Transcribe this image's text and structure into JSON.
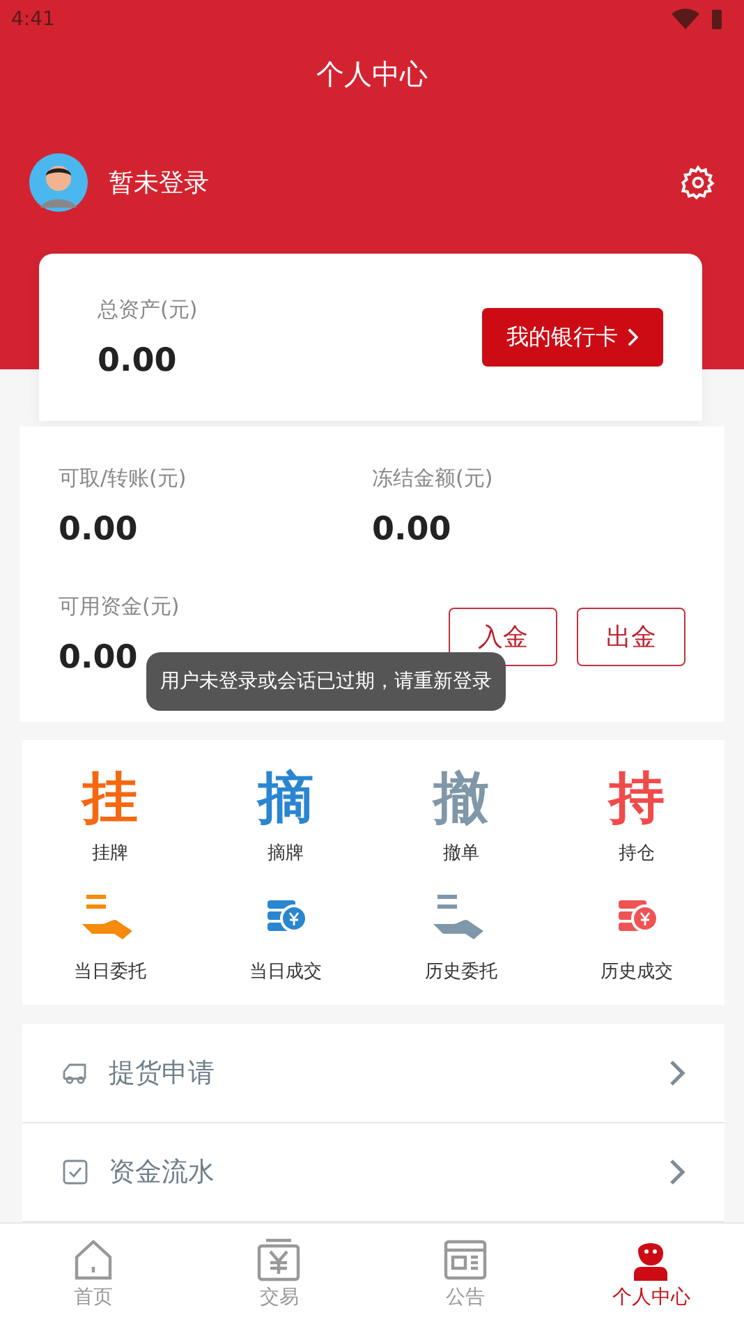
{
  "status_bar": {
    "time": "4:41"
  },
  "header": {
    "title": "个人中心",
    "user_name": "暂未登录"
  },
  "total_assets": {
    "label": "总资产(元)",
    "value": "0.00",
    "button": "我的银行卡"
  },
  "balances": [
    {
      "label": "可取/转账(元)",
      "value": "0.00"
    },
    {
      "label": "冻结金额(元)",
      "value": "0.00"
    },
    {
      "label": "可用资金(元)",
      "value": "0.00"
    }
  ],
  "fund_buttons": [
    "入金",
    "出金"
  ],
  "toast": "用户未登录或会话已过期，请重新登录",
  "shortcuts": [
    {
      "kind": "char",
      "glyph": "挂",
      "label": "挂牌",
      "color": "#f5680f"
    },
    {
      "kind": "char",
      "glyph": "摘",
      "label": "摘牌",
      "color": "#2a86d0"
    },
    {
      "kind": "char",
      "glyph": "撤",
      "label": "撤单",
      "color": "#7f97a8"
    },
    {
      "kind": "char",
      "glyph": "持",
      "label": "持仓",
      "color": "#ef4b4b"
    },
    {
      "kind": "hand",
      "label": "当日委托",
      "color": "#f58a0c"
    },
    {
      "kind": "coins",
      "label": "当日成交",
      "color": "#2a86d0"
    },
    {
      "kind": "hand",
      "label": "历史委托",
      "color": "#7f97a8"
    },
    {
      "kind": "coins",
      "label": "历史成交",
      "color": "#ef5454"
    }
  ],
  "menu": [
    {
      "kind": "truck",
      "label": "提货申请"
    },
    {
      "kind": "check",
      "label": "资金流水"
    }
  ],
  "tabs": [
    {
      "kind": "home",
      "label": "首页",
      "selected": false
    },
    {
      "kind": "trade",
      "label": "交易",
      "selected": false
    },
    {
      "kind": "notice",
      "label": "公告",
      "selected": false
    },
    {
      "kind": "user",
      "label": "个人中心",
      "selected": true
    }
  ]
}
